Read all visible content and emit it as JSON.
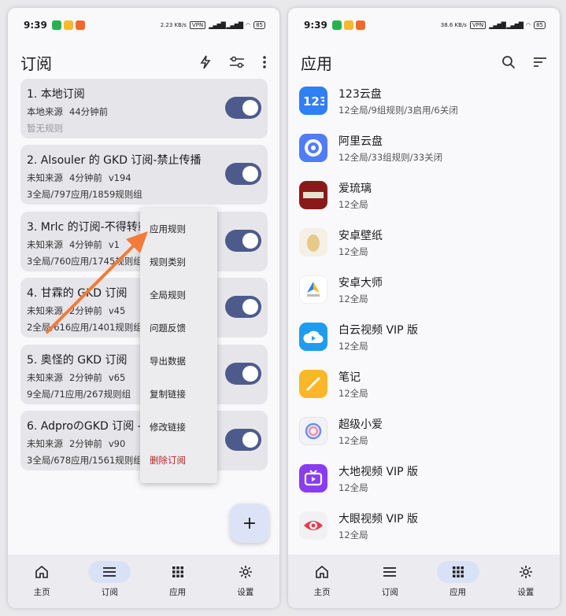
{
  "left": {
    "status": {
      "time": "9:39",
      "speed": "2.23 KB/s",
      "vpn": "VPN",
      "battery": "85"
    },
    "title": "订阅",
    "subscriptions": [
      {
        "title": "1. 本地订阅",
        "source": "本地来源",
        "time": "44分钟前",
        "version": "",
        "stats": "暂无规则",
        "muted": true
      },
      {
        "title": "2. Alsouler 的 GKD 订阅-禁止传播",
        "source": "未知来源",
        "time": "4分钟前",
        "version": "v194",
        "stats": "3全局/797应用/1859规则组"
      },
      {
        "title": "3. Mrlc 的订阅-不得转载",
        "source": "未知来源",
        "time": "4分钟前",
        "version": "v1",
        "stats": "3全局/760应用/1745规则组"
      },
      {
        "title": "4. 甘霖的 GKD 订阅",
        "source": "未知来源",
        "time": "2分钟前",
        "version": "v45",
        "stats": "2全局/616应用/1401规则组"
      },
      {
        "title": "5. 奥怪的 GKD 订阅",
        "source": "未知来源",
        "time": "2分钟前",
        "version": "v65",
        "stats": "9全局/71应用/267规则组"
      },
      {
        "title": "6. AdproのGKD 订阅 -",
        "source": "未知来源",
        "time": "2分钟前",
        "version": "v90",
        "stats": "3全局/678应用/1561规则组"
      }
    ],
    "menu": [
      "应用规则",
      "规则类别",
      "全局规则",
      "问题反馈",
      "导出数据",
      "复制链接",
      "修改链接",
      "删除订阅"
    ],
    "fab": "+"
  },
  "right": {
    "status": {
      "time": "9:39",
      "speed": "38.6 KB/s",
      "vpn": "VPN",
      "battery": "85"
    },
    "title": "应用",
    "apps": [
      {
        "name": "123云盘",
        "info": "12全局/9组规则/3启用/6关闭"
      },
      {
        "name": "阿里云盘",
        "info": "12全局/33组规则/33关闭"
      },
      {
        "name": "爱琉璃",
        "info": "12全局"
      },
      {
        "name": "安卓壁纸",
        "info": "12全局"
      },
      {
        "name": "安卓大师",
        "info": "12全局"
      },
      {
        "name": "白云视频 VIP 版",
        "info": "12全局"
      },
      {
        "name": "笔记",
        "info": "12全局"
      },
      {
        "name": "超级小爱",
        "info": "12全局"
      },
      {
        "name": "大地视频 VIP 版",
        "info": "12全局"
      },
      {
        "name": "大眼视频 VIP 版",
        "info": "12全局"
      }
    ]
  },
  "nav": [
    "主页",
    "订阅",
    "应用",
    "设置"
  ],
  "colors": {
    "accent": "#4d5b8c",
    "pill": "#d9e1f6",
    "danger": "#b3261e"
  }
}
